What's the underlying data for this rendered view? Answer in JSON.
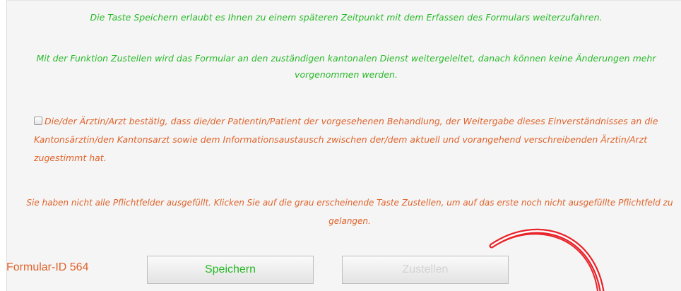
{
  "info": {
    "save_text": "Die Taste Speichern erlaubt es Ihnen zu einem späteren Zeitpunkt mit dem Erfassen des Formulars weiterzufahren.",
    "send_text": "Mit der Funktion Zustellen wird das Formular an den zuständigen kantonalen Dienst weitergeleitet, danach können keine Änderungen mehr vorgenommen werden."
  },
  "consent": {
    "checked": false,
    "label": "Die/der Ärztin/Arzt bestätig, dass die/der Patientin/Patient der vorgesehenen Behandlung, der Weitergabe dieses Einverständnisses an die Kantonsärztin/den Kantonsarzt sowie dem Informationsaustausch zwischen der/dem aktuell und vorangehend verschreibenden Ärztin/Arzt zugestimmt hat."
  },
  "warning": "Sie haben nicht alle Pflichtfelder ausgefüllt. Klicken Sie auf die grau erscheinende Taste Zustellen, um auf das erste noch nicht ausgefüllte Pflichtfeld zu gelangen.",
  "form_id": "Formular-ID 564",
  "buttons": {
    "save_label": "Speichern",
    "send_label": "Zustellen",
    "send_disabled": true
  },
  "colors": {
    "info_text": "#27b927",
    "warning_text": "#e0622a",
    "annotation": "#e8242b"
  }
}
